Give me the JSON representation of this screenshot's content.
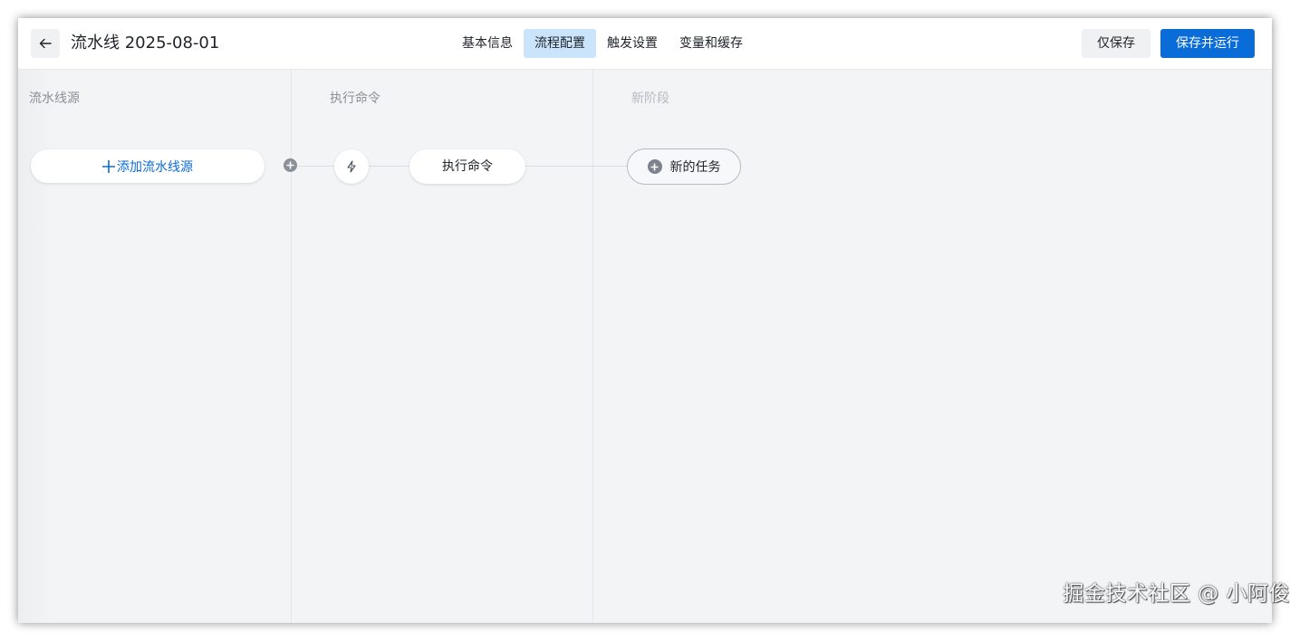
{
  "header": {
    "title": "流水线 2025-08-01",
    "tabs": [
      {
        "label": "基本信息",
        "active": false
      },
      {
        "label": "流程配置",
        "active": true
      },
      {
        "label": "触发设置",
        "active": false
      },
      {
        "label": "变量和缓存",
        "active": false
      }
    ],
    "save_only_label": "仅保存",
    "save_run_label": "保存并运行"
  },
  "columns": {
    "source": {
      "title": "流水线源",
      "add_source_label": "添加流水线源"
    },
    "stage1": {
      "title": "执行命令",
      "task_label": "执行命令"
    },
    "stage2": {
      "title": "新阶段",
      "new_task_label": "新的任务"
    }
  },
  "watermark": "掘金技术社区 @ 小阿俊",
  "colors": {
    "primary": "#0a6cd8",
    "active_tab_bg": "#c9e4fb",
    "canvas_bg": "#f2f4f6"
  },
  "icons": {
    "back": "arrow-left-icon",
    "trigger": "lightning-icon",
    "add": "plus-circle-icon"
  }
}
